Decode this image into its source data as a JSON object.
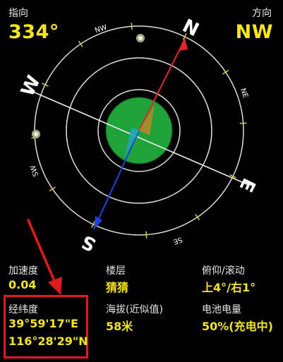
{
  "heading": {
    "label": "指向",
    "value": "334°"
  },
  "direction": {
    "label": "方向",
    "value": "NW"
  },
  "compass": {
    "cardinals": [
      "N",
      "E",
      "S",
      "W"
    ],
    "intercardinals": [
      "NW",
      "NE",
      "SE",
      "SW"
    ],
    "heading_deg": 334,
    "accent_north": "#e8242b",
    "accent_south": "#2040e0",
    "bubble_color": "#1fa338"
  },
  "stats": {
    "acceleration": {
      "label": "加速度",
      "value": "0.04"
    },
    "floor": {
      "label": "楼层",
      "value": "猜猜"
    },
    "pitch_roll": {
      "label": "俯仰/滚动",
      "value": "上4°/右1°"
    },
    "lat_long": {
      "label": "经纬度",
      "lat": "39°59'17\"E",
      "long": "116°28'29\"N"
    },
    "altitude": {
      "label": "海拔(近似值)",
      "value": "58米"
    },
    "battery": {
      "label": "电池电量",
      "value": "50%(充电中)"
    }
  }
}
